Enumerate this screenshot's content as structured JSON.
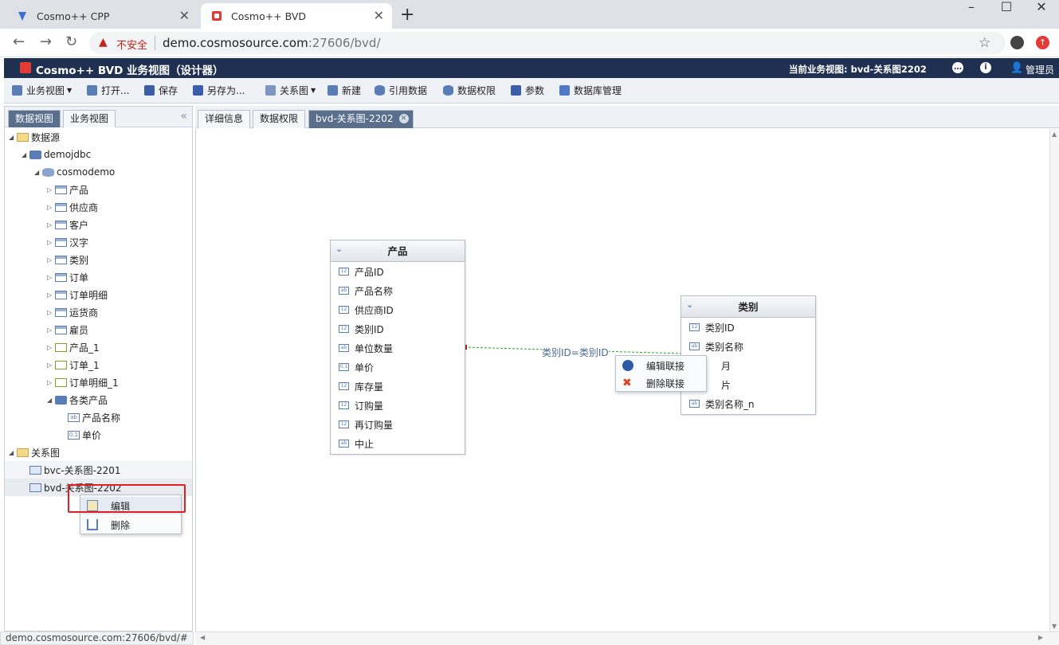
{
  "browser": {
    "tabs": [
      {
        "title": "Cosmo++ CPP",
        "active": false
      },
      {
        "title": "Cosmo++ BVD",
        "active": true
      }
    ],
    "address": {
      "security": "不安全",
      "host": "demo.cosmosource.com",
      "rest": ":27606/bvd/"
    }
  },
  "app": {
    "title": "Cosmo++ BVD 业务视图（设计器）",
    "current_view": "当前业务视图: bvd-关系图2202",
    "user": "管理员"
  },
  "toolbar": {
    "items": [
      "业务视图",
      "打开...",
      "保存",
      "另存为...",
      "关系图",
      "新建",
      "引用数据",
      "数据权限",
      "参数",
      "数据库管理"
    ]
  },
  "left": {
    "tabs": [
      "数据视图",
      "业务视图"
    ],
    "tree": {
      "datasource": "数据源",
      "conn": "demojdbc",
      "schema": "cosmodemo",
      "tables": [
        "产品",
        "供应商",
        "客户",
        "汉字",
        "类别",
        "订单",
        "订单明细",
        "运货商",
        "雇员"
      ],
      "views": [
        "产品_1",
        "订单_1",
        "订单明细_1"
      ],
      "group": "各类产品",
      "group_fields": [
        "产品名称",
        "单价"
      ],
      "relations_root": "关系图",
      "relations": [
        "bvc-关系图-2201",
        "bvd-关系图-2202"
      ]
    },
    "context_menu": [
      "编辑",
      "删除"
    ]
  },
  "main": {
    "tabs": [
      "详细信息",
      "数据权限",
      "bvd-关系图-2202"
    ],
    "entity1": {
      "name": "产品",
      "fields": [
        {
          "name": "产品ID",
          "type": "12"
        },
        {
          "name": "产品名称",
          "type": "ab"
        },
        {
          "name": "供应商ID",
          "type": "12"
        },
        {
          "name": "类别ID",
          "type": "12"
        },
        {
          "name": "单位数量",
          "type": "ab"
        },
        {
          "name": "单价",
          "type": "0.1"
        },
        {
          "name": "库存量",
          "type": "12"
        },
        {
          "name": "订购量",
          "type": "12"
        },
        {
          "name": "再订购量",
          "type": "12"
        },
        {
          "name": "中止",
          "type": "ab"
        }
      ]
    },
    "entity2": {
      "name": "类别",
      "fields": [
        {
          "name": "类别ID",
          "type": "12"
        },
        {
          "name": "类别名称",
          "type": "ab"
        },
        {
          "name": "月",
          "type": "ab"
        },
        {
          "name": "片",
          "type": "ab"
        },
        {
          "name": "类别名称_n",
          "type": "ab"
        }
      ]
    },
    "link_label": "类别ID=类别ID",
    "link_menu": [
      "编辑联接",
      "删除联接"
    ]
  },
  "status_url": "demo.cosmosource.com:27606/bvd/#"
}
